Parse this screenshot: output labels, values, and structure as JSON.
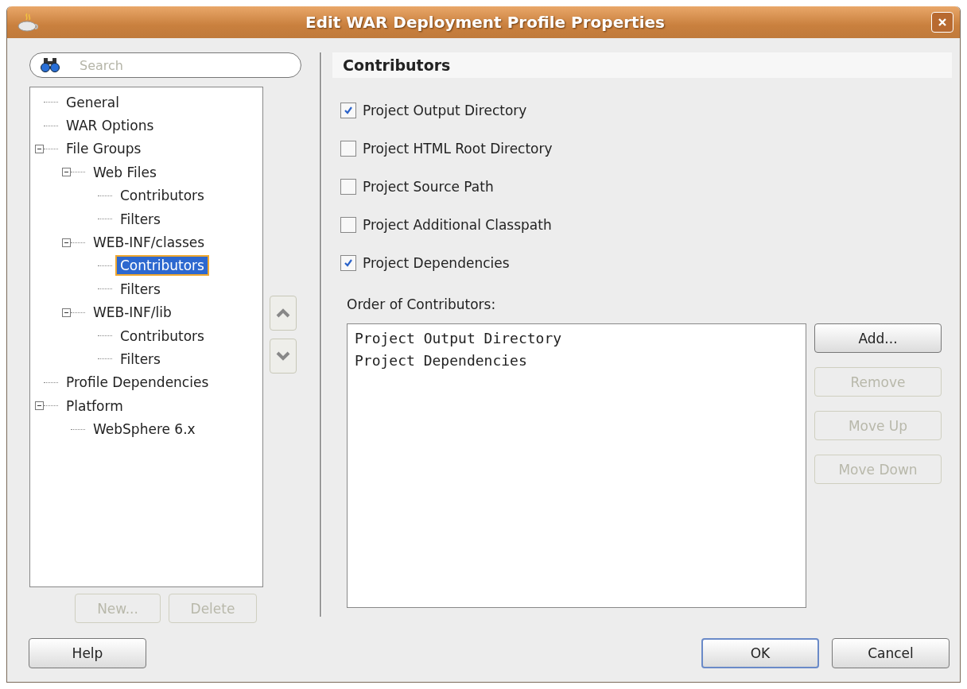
{
  "window": {
    "title": "Edit WAR Deployment Profile Properties"
  },
  "search": {
    "placeholder": "Search"
  },
  "tree": [
    {
      "label": "General",
      "selected": false
    },
    {
      "label": "WAR Options",
      "selected": false
    },
    {
      "label": "File Groups",
      "selected": false,
      "expanded": true,
      "children": [
        {
          "label": "Web Files",
          "selected": false,
          "expanded": true,
          "children": [
            {
              "label": "Contributors",
              "selected": false
            },
            {
              "label": "Filters",
              "selected": false
            }
          ]
        },
        {
          "label": "WEB-INF/classes",
          "selected": false,
          "expanded": true,
          "children": [
            {
              "label": "Contributors",
              "selected": true
            },
            {
              "label": "Filters",
              "selected": false
            }
          ]
        },
        {
          "label": "WEB-INF/lib",
          "selected": false,
          "expanded": true,
          "children": [
            {
              "label": "Contributors",
              "selected": false
            },
            {
              "label": "Filters",
              "selected": false
            }
          ]
        }
      ]
    },
    {
      "label": "Profile Dependencies",
      "selected": false
    },
    {
      "label": "Platform",
      "selected": false,
      "expanded": true,
      "children": [
        {
          "label": "WebSphere 6.x",
          "selected": false
        }
      ]
    }
  ],
  "tree_buttons": [
    {
      "label": "New...",
      "disabled": true
    },
    {
      "label": "Delete",
      "disabled": true
    }
  ],
  "panel": {
    "title": "Contributors",
    "options": [
      {
        "label": "Project Output Directory",
        "checked": true
      },
      {
        "label": "Project HTML Root Directory",
        "checked": false
      },
      {
        "label": "Project Source Path",
        "checked": false
      },
      {
        "label": "Project Additional Classpath",
        "checked": false
      },
      {
        "label": "Project Dependencies",
        "checked": true
      }
    ],
    "order_label": "Order of Contributors:",
    "order_items": [
      "Project Output Directory",
      "Project Dependencies"
    ],
    "order_buttons": [
      {
        "label": "Add...",
        "disabled": false
      },
      {
        "label": "Remove",
        "disabled": true
      },
      {
        "label": "Move Up",
        "disabled": true
      },
      {
        "label": "Move Down",
        "disabled": true
      }
    ]
  },
  "footer_buttons": [
    {
      "label": "Help",
      "default": false
    },
    {
      "label": "OK",
      "default": true
    },
    {
      "label": "Cancel",
      "default": false
    }
  ]
}
